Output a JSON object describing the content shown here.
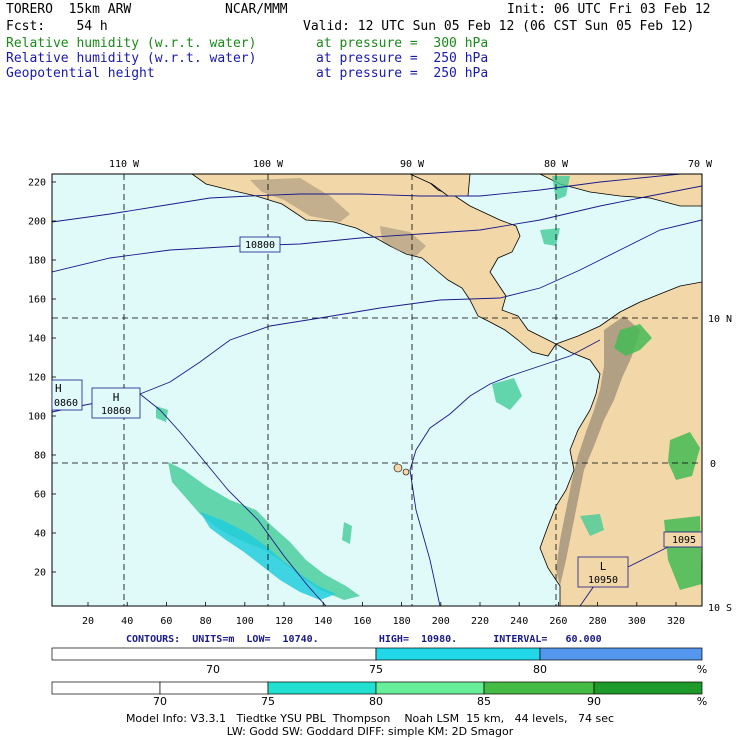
{
  "header": {
    "model": "TORERO  15km ARW",
    "org": "NCAR/MMM",
    "init": "Init: 06 UTC Fri 03 Feb 12",
    "fcst": "Fcst:    54 h",
    "valid": "Valid: 12 UTC Sun 05 Feb 12 (06 CST Sun 05 Feb 12)",
    "fields": [
      {
        "name": "Relative humidity (w.r.t. water)",
        "level": "at pressure =  300 hPa",
        "color": "#1a8a1a"
      },
      {
        "name": "Relative humidity (w.r.t. water)",
        "level": "at pressure =  250 hPa",
        "color": "#1a1aaa"
      },
      {
        "name": "Geopotential height",
        "level": "at pressure =  250 hPa",
        "color": "#1a1aaa"
      }
    ]
  },
  "map": {
    "top_lon_labels": [
      "110 W",
      "100 W",
      "90 W",
      "80 W",
      "70 W"
    ],
    "right_lat_labels": [
      "10 N",
      "0",
      "10 S"
    ],
    "left_y_ticks": [
      "220",
      "200",
      "180",
      "160",
      "140",
      "120",
      "100",
      "80",
      "60",
      "40",
      "20"
    ],
    "bottom_x_ticks": [
      "20",
      "40",
      "60",
      "80",
      "100",
      "120",
      "140",
      "160",
      "180",
      "200",
      "220",
      "240",
      "260",
      "280",
      "300",
      "320"
    ],
    "contour_labels": [
      {
        "text": "10800"
      },
      {
        "text": "10860",
        "marker": "H"
      },
      {
        "text": "0860",
        "marker": "H"
      },
      {
        "text": "10950",
        "marker": "L"
      },
      {
        "text": "1095"
      }
    ],
    "colors": {
      "ocean": "#e0fafa",
      "land": "#f2d8a8",
      "terrain": "#8c8070",
      "contour": "#1a1a88"
    }
  },
  "contours_info": {
    "text": "CONTOURS:  UNITS=m  LOW=  10740.          HIGH=  10980.      INTERVAL=   60.000"
  },
  "colorbar1": {
    "labels": [
      "70",
      "75",
      "80",
      "%"
    ],
    "segments": [
      {
        "color": "#ffffff"
      },
      {
        "color": "#22d8e8"
      },
      {
        "color": "#5596ee"
      }
    ]
  },
  "colorbar2": {
    "labels": [
      "70",
      "75",
      "80",
      "85",
      "90",
      "%"
    ],
    "segments": [
      {
        "color": "#ffffff"
      },
      {
        "color": "#ffffff"
      },
      {
        "color": "#22e0d0"
      },
      {
        "color": "#66ee99"
      },
      {
        "color": "#44bb44"
      },
      {
        "color": "#1e9a2a"
      }
    ]
  },
  "footer": {
    "line1": "Model Info: V3.3.1   Tiedtke YSU PBL  Thompson    Noah LSM  15 km,   44 levels,   74 sec",
    "line2": "LW: Godd SW: Goddard DIFF: simple KM: 2D Smagor"
  }
}
